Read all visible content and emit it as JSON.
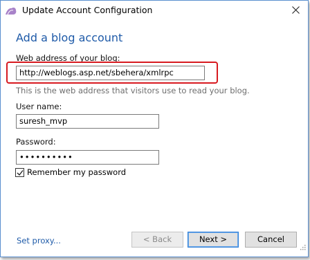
{
  "window": {
    "title": "Update Account Configuration"
  },
  "heading": "Add a blog account",
  "blog_address": {
    "label": "Web address of your blog:",
    "value": "http://weblogs.asp.net/sbehera/xmlrpc",
    "hint": "This is the web address that visitors use to read your blog."
  },
  "username": {
    "label": "User name:",
    "value": "suresh_mvp"
  },
  "password": {
    "label": "Password:",
    "value": "••••••••••"
  },
  "remember": {
    "label": "Remember my password",
    "checked": true
  },
  "footer": {
    "proxy_link": "Set proxy...",
    "back_label": "< Back",
    "next_label": "Next >",
    "cancel_label": "Cancel"
  },
  "colors": {
    "heading": "#1e5aa8",
    "highlight": "#d7191f",
    "accent": "#2f7fd8"
  },
  "icons": [
    "app-icon",
    "close-icon",
    "check-icon",
    "resize-grip-icon"
  ]
}
